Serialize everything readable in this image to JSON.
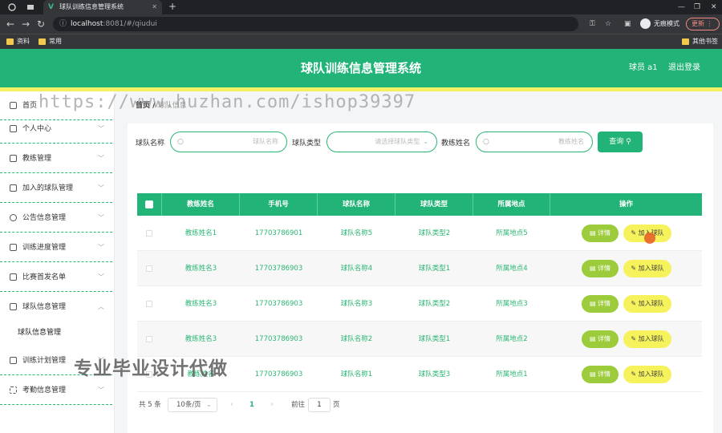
{
  "browser": {
    "tab_title": "球队训练信息管理系统",
    "url_host": "localhost",
    "url_path": ":8081/#/qiudui",
    "incognito_label": "无痕模式",
    "update_label": "更新",
    "bookmarks": [
      "资料",
      "常用"
    ],
    "other_bookmarks": "其他书签"
  },
  "header": {
    "title": "球队训练信息管理系统",
    "user": "球员 a1",
    "logout": "退出登录",
    "accent_color": "#21b377",
    "strip_color": "#f4f064"
  },
  "sidebar": {
    "items": [
      {
        "label": "首页",
        "icon": "home-icon"
      },
      {
        "label": "个人中心",
        "icon": "user-icon"
      },
      {
        "label": "教练管理",
        "icon": "id-card-icon"
      },
      {
        "label": "加入的球队管理",
        "icon": "ticket-icon"
      },
      {
        "label": "公告信息管理",
        "icon": "clock-icon"
      },
      {
        "label": "训练进度管理",
        "icon": "bar-chart-icon"
      },
      {
        "label": "比赛首发名单",
        "icon": "building-icon"
      },
      {
        "label": "球队信息管理",
        "icon": "data-icon"
      },
      {
        "label": "训练计划管理",
        "icon": "document-icon"
      },
      {
        "label": "考勤信息管理",
        "icon": "scan-icon"
      }
    ],
    "sub_item": "球队信息管理"
  },
  "breadcrumb": {
    "home": "首页",
    "current": "球队信息"
  },
  "filters": {
    "team_name_label": "球队名称",
    "team_name_placeholder": "球队名称",
    "team_type_label": "球队类型",
    "team_type_placeholder": "请选择球队类型",
    "coach_name_label": "教练姓名",
    "coach_name_placeholder": "教练姓名",
    "query_button": "查询"
  },
  "table": {
    "columns": [
      "教练姓名",
      "手机号",
      "球队名称",
      "球队类型",
      "所属地点",
      "操作"
    ],
    "rows": [
      {
        "coach": "教练姓名1",
        "phone": "17703786901",
        "team": "球队名称5",
        "type": "球队类型2",
        "location": "所属地点5"
      },
      {
        "coach": "教练姓名3",
        "phone": "17703786903",
        "team": "球队名称4",
        "type": "球队类型1",
        "location": "所属地点4"
      },
      {
        "coach": "教练姓名3",
        "phone": "17703786903",
        "team": "球队名称3",
        "type": "球队类型2",
        "location": "所属地点3"
      },
      {
        "coach": "教练姓名3",
        "phone": "17703786903",
        "team": "球队名称2",
        "type": "球队类型1",
        "location": "所属地点2"
      },
      {
        "coach": "教练姓名",
        "phone": "17703786903",
        "team": "球队名称1",
        "type": "球队类型3",
        "location": "所属地点1"
      }
    ],
    "detail_button": "详情",
    "join_button": "加入球队"
  },
  "pagination": {
    "total": "共 5 条",
    "page_size": "10条/页",
    "current_page": "1",
    "goto_label": "前往",
    "goto_value": "1",
    "page_unit": "页"
  },
  "overlay": {
    "watermark": "https://www.huzhan.com/ishop39397",
    "promo": "专业毕业设计代做"
  }
}
